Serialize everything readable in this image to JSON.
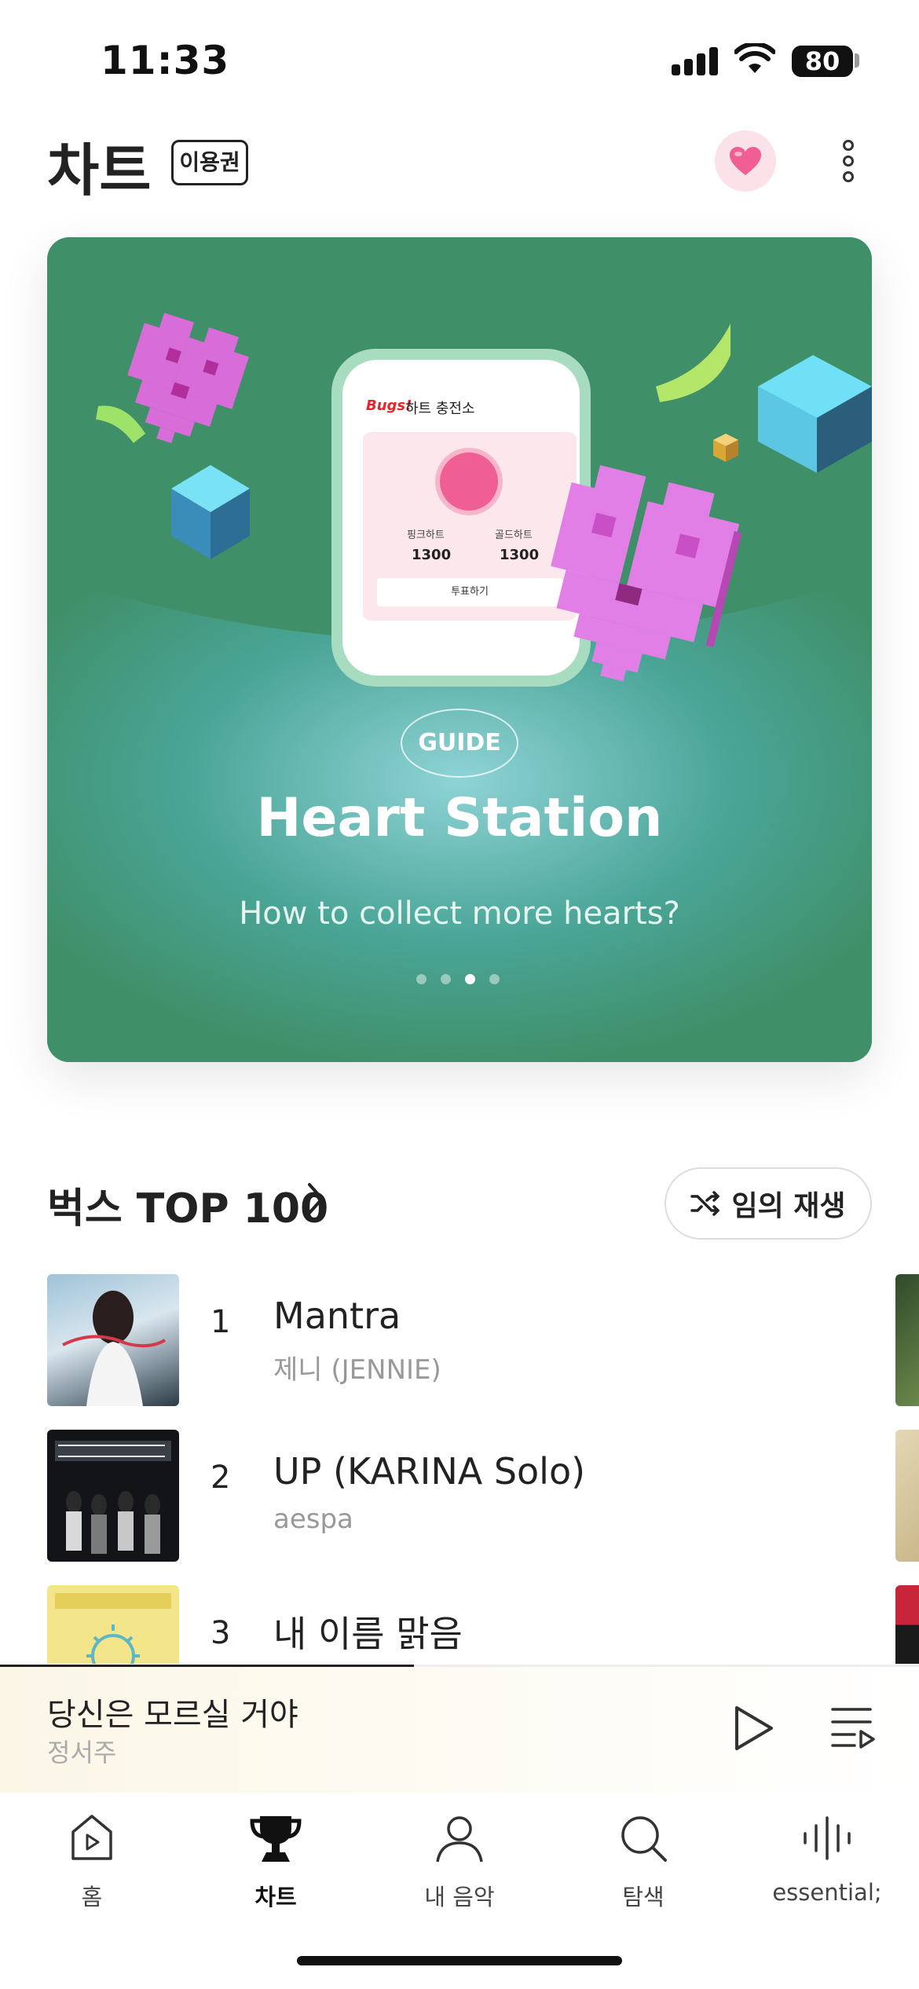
{
  "status_bar": {
    "time": "11:33",
    "battery": "80"
  },
  "header": {
    "title": "차트",
    "pass_badge": "이용권"
  },
  "banner": {
    "tag": "GUIDE",
    "title": "Heart Station",
    "subtitle": "How to collect more hearts?",
    "page_count": 4,
    "active_page": 3,
    "phone": {
      "logo": "Bugs!",
      "title": "하트 충전소",
      "pink_label": "핑크하트",
      "pink_value": "1300",
      "gold_label": "골드하트",
      "gold_value": "1300",
      "vote": "투표하기"
    },
    "colors": {
      "background": "#3f8f68",
      "accent": "#ef5f93"
    }
  },
  "section": {
    "title": "벅스 TOP 100",
    "shuffle_label": "임의 재생"
  },
  "chart": [
    {
      "rank": "1",
      "title": "Mantra",
      "artist": "제니 (JENNIE)"
    },
    {
      "rank": "2",
      "title": "UP (KARINA Solo)",
      "artist": "aespa"
    },
    {
      "rank": "3",
      "title": "내 이름 맑음",
      "artist": ""
    }
  ],
  "mini_player": {
    "title": "당신은 모르실 거야",
    "artist": "정서주",
    "progress": 0.45
  },
  "tabs": [
    {
      "label": "홈",
      "icon": "home-play-icon",
      "active": false
    },
    {
      "label": "차트",
      "icon": "trophy-icon",
      "active": true
    },
    {
      "label": "내 음악",
      "icon": "person-icon",
      "active": false
    },
    {
      "label": "탐색",
      "icon": "search-icon",
      "active": false
    },
    {
      "label": "essential;",
      "icon": "waveform-icon",
      "active": false
    }
  ]
}
